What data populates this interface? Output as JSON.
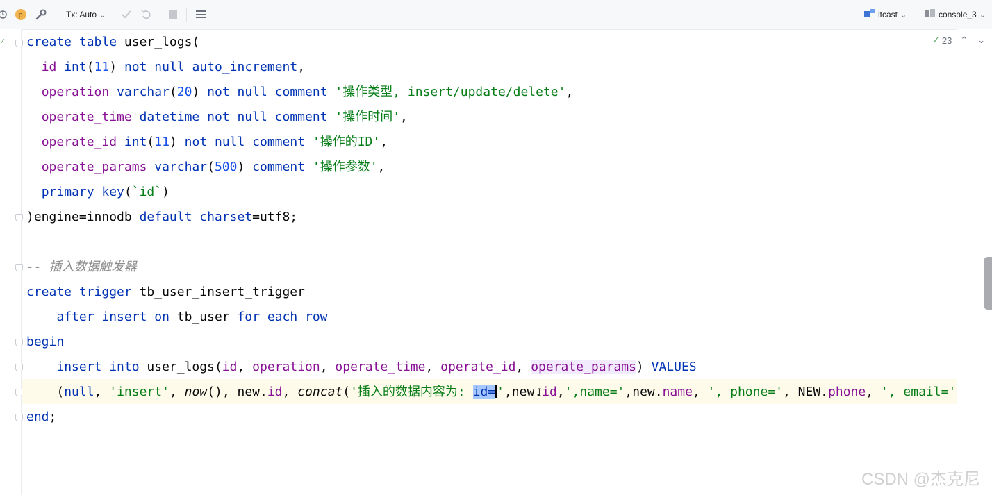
{
  "toolbar": {
    "tx_label": "Tx: Auto",
    "datasource_label": "itcast",
    "console_label": "console_3",
    "icons": [
      "history-icon",
      "profile-p-icon",
      "wrench-icon",
      "commit-check-icon",
      "rollback-icon",
      "stop-icon",
      "grid-table-icon",
      "datasource-icon",
      "console-icon"
    ]
  },
  "inspection": {
    "count": "23"
  },
  "editor": {
    "lines": [
      [
        [
          "kw",
          "create"
        ],
        [
          "plain",
          " "
        ],
        [
          "kw",
          "table"
        ],
        [
          "plain",
          " user_logs("
        ]
      ],
      [
        [
          "plain",
          "  "
        ],
        [
          "col",
          "id"
        ],
        [
          "plain",
          " "
        ],
        [
          "kw",
          "int"
        ],
        [
          "plain",
          "("
        ],
        [
          "num",
          "11"
        ],
        [
          "plain",
          ") "
        ],
        [
          "kw",
          "not null auto_increment"
        ],
        [
          "plain",
          ","
        ]
      ],
      [
        [
          "plain",
          "  "
        ],
        [
          "col",
          "operation"
        ],
        [
          "plain",
          " "
        ],
        [
          "kw",
          "varchar"
        ],
        [
          "plain",
          "("
        ],
        [
          "num",
          "20"
        ],
        [
          "plain",
          ") "
        ],
        [
          "kw",
          "not null comment"
        ],
        [
          "plain",
          " "
        ],
        [
          "str",
          "'操作类型, insert/update/delete'"
        ],
        [
          "plain",
          ","
        ]
      ],
      [
        [
          "plain",
          "  "
        ],
        [
          "col",
          "operate_time"
        ],
        [
          "plain",
          " "
        ],
        [
          "kw",
          "datetime not null comment"
        ],
        [
          "plain",
          " "
        ],
        [
          "str",
          "'操作时间'"
        ],
        [
          "plain",
          ","
        ]
      ],
      [
        [
          "plain",
          "  "
        ],
        [
          "col",
          "operate_id"
        ],
        [
          "plain",
          " "
        ],
        [
          "kw",
          "int"
        ],
        [
          "plain",
          "("
        ],
        [
          "num",
          "11"
        ],
        [
          "plain",
          ") "
        ],
        [
          "kw",
          "not null comment"
        ],
        [
          "plain",
          " "
        ],
        [
          "str",
          "'操作的ID'"
        ],
        [
          "plain",
          ","
        ]
      ],
      [
        [
          "plain",
          "  "
        ],
        [
          "col",
          "operate_params"
        ],
        [
          "plain",
          " "
        ],
        [
          "kw",
          "varchar"
        ],
        [
          "plain",
          "("
        ],
        [
          "num",
          "500"
        ],
        [
          "plain",
          ") "
        ],
        [
          "kw",
          "comment"
        ],
        [
          "plain",
          " "
        ],
        [
          "str",
          "'操作参数'"
        ],
        [
          "plain",
          ","
        ]
      ],
      [
        [
          "plain",
          "  "
        ],
        [
          "kw",
          "primary key"
        ],
        [
          "plain",
          "("
        ],
        [
          "str",
          "`id`"
        ],
        [
          "plain",
          ")"
        ]
      ],
      [
        [
          "plain",
          ")engine=innodb "
        ],
        [
          "kw",
          "default charset"
        ],
        [
          "plain",
          "=utf8;"
        ]
      ],
      [],
      [
        [
          "cmt",
          "-- 插入数据触发器"
        ]
      ],
      [
        [
          "kw",
          "create trigger"
        ],
        [
          "plain",
          " tb_user_insert_trigger"
        ]
      ],
      [
        [
          "plain",
          "    "
        ],
        [
          "kw",
          "after insert on"
        ],
        [
          "plain",
          " tb_user "
        ],
        [
          "kw",
          "for each row"
        ]
      ],
      [
        [
          "kw",
          "begin"
        ]
      ],
      [
        [
          "plain",
          "    "
        ],
        [
          "kw",
          "insert into"
        ],
        [
          "plain",
          " user_logs("
        ],
        [
          "col",
          "id"
        ],
        [
          "plain",
          ", "
        ],
        [
          "col",
          "operation"
        ],
        [
          "plain",
          ", "
        ],
        [
          "col",
          "operate_time"
        ],
        [
          "plain",
          ", "
        ],
        [
          "col",
          "operate_id"
        ],
        [
          "plain",
          ", "
        ],
        [
          "colhl",
          "operate_params"
        ],
        [
          "plain",
          ") "
        ],
        [
          "kw",
          "VALUES"
        ]
      ],
      [
        [
          "plain",
          "    ("
        ],
        [
          "kw",
          "null"
        ],
        [
          "plain",
          ", "
        ],
        [
          "str",
          "'insert'"
        ],
        [
          "plain",
          ", "
        ],
        [
          "fn",
          "now"
        ],
        [
          "plain",
          "(), new."
        ],
        [
          "col",
          "id"
        ],
        [
          "plain",
          ", "
        ],
        [
          "fn",
          "concat"
        ],
        [
          "plain",
          "("
        ],
        [
          "str",
          "'插入的数据内容为: "
        ],
        [
          "sel",
          "id="
        ],
        [
          "caret",
          ""
        ],
        [
          "str",
          "'"
        ],
        [
          "plain",
          ",new."
        ],
        [
          "col",
          "id"
        ],
        [
          "plain",
          ","
        ],
        [
          "str",
          "',name='"
        ],
        [
          "plain",
          ",new."
        ],
        [
          "col",
          "name"
        ],
        [
          "plain",
          ", "
        ],
        [
          "str",
          "', phone='"
        ],
        [
          "plain",
          ", NEW."
        ],
        [
          "col",
          "phone"
        ],
        [
          "plain",
          ", "
        ],
        [
          "str",
          "', email='"
        ],
        [
          "plain",
          ","
        ]
      ],
      [
        [
          "kw",
          "end"
        ],
        [
          "plain",
          ";"
        ]
      ]
    ]
  },
  "watermark": "CSDN @杰克尼"
}
